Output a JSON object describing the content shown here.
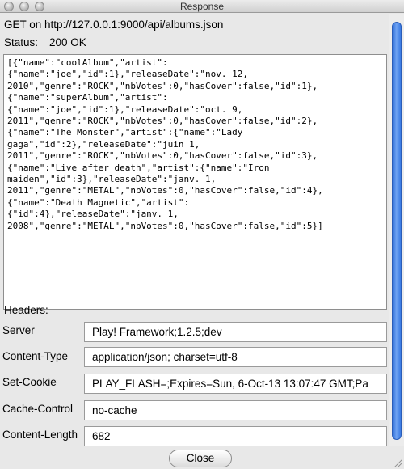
{
  "window": {
    "title": "Response"
  },
  "request": {
    "line": "GET on http://127.0.0.1:9000/api/albums.json"
  },
  "status": {
    "label": "Status:",
    "value": "200 OK"
  },
  "response_body": "[{\"name\":\"coolAlbum\",\"artist\":\n{\"name\":\"joe\",\"id\":1},\"releaseDate\":\"nov. 12,\n2010\",\"genre\":\"ROCK\",\"nbVotes\":0,\"hasCover\":false,\"id\":1},\n{\"name\":\"superAlbum\",\"artist\":\n{\"name\":\"joe\",\"id\":1},\"releaseDate\":\"oct. 9,\n2011\",\"genre\":\"ROCK\",\"nbVotes\":0,\"hasCover\":false,\"id\":2},\n{\"name\":\"The Monster\",\"artist\":{\"name\":\"Lady\ngaga\",\"id\":2},\"releaseDate\":\"juin 1,\n2011\",\"genre\":\"ROCK\",\"nbVotes\":0,\"hasCover\":false,\"id\":3},\n{\"name\":\"Live after death\",\"artist\":{\"name\":\"Iron\nmaiden\",\"id\":3},\"releaseDate\":\"janv. 1,\n2011\",\"genre\":\"METAL\",\"nbVotes\":0,\"hasCover\":false,\"id\":4},\n{\"name\":\"Death Magnetic\",\"artist\":\n{\"id\":4},\"releaseDate\":\"janv. 1,\n2008\",\"genre\":\"METAL\",\"nbVotes\":0,\"hasCover\":false,\"id\":5}]",
  "headers": {
    "title": "Headers:",
    "items": [
      {
        "label": "Server",
        "value": "Play! Framework;1.2.5;dev"
      },
      {
        "label": "Content-Type",
        "value": "application/json; charset=utf-8"
      },
      {
        "label": "Set-Cookie",
        "value": "PLAY_FLASH=;Expires=Sun, 6-Oct-13 13:07:47 GMT;Pa"
      },
      {
        "label": "Cache-Control",
        "value": "no-cache"
      },
      {
        "label": "Content-Length",
        "value": "682"
      }
    ]
  },
  "footer": {
    "close_label": "Close"
  },
  "colors": {
    "scroll_thumb": "#3a7ae3",
    "window_bg": "#e8e8e8"
  }
}
